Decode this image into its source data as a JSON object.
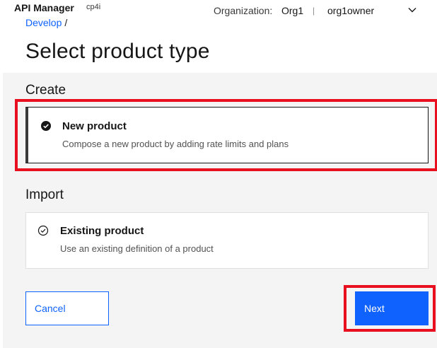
{
  "header": {
    "app_title": "API Manager",
    "app_subtitle": "cp4i",
    "org_label": "Organization:",
    "org_value": "Org1",
    "separator": "|",
    "user": "org1owner",
    "menu_icon": "chevron-down-icon"
  },
  "breadcrumb": {
    "items": [
      {
        "label": "Develop"
      }
    ],
    "separator": "/"
  },
  "page_title": "Select product type",
  "sections": {
    "create": {
      "heading": "Create",
      "tile": {
        "title": "New product",
        "description": "Compose a new product by adding rate limits and plans",
        "icon": "checkmark-filled-icon",
        "selected": true
      }
    },
    "import": {
      "heading": "Import",
      "tile": {
        "title": "Existing product",
        "description": "Use an existing definition of a product",
        "icon": "checkmark-outline-icon",
        "selected": false
      }
    }
  },
  "buttons": {
    "cancel": "Cancel",
    "next": "Next"
  },
  "colors": {
    "accent": "#0f62fe",
    "highlight": "#e8101f",
    "panel_bg": "#f4f4f4"
  }
}
